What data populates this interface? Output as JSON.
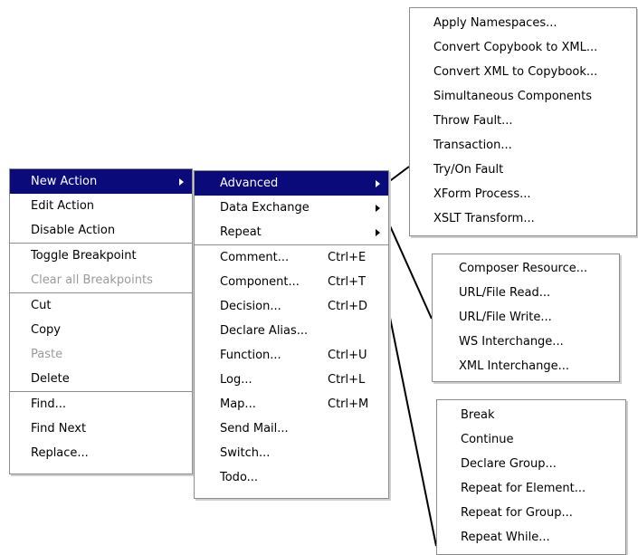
{
  "context_menu": {
    "items": [
      {
        "label": "New Action",
        "has_submenu": true,
        "selected": true
      },
      {
        "label": "Edit Action"
      },
      {
        "label": "Disable Action"
      },
      {
        "label": "Toggle Breakpoint"
      },
      {
        "label": "Clear all Breakpoints",
        "disabled": true
      },
      {
        "label": "Cut"
      },
      {
        "label": "Copy"
      },
      {
        "label": "Paste",
        "disabled": true
      },
      {
        "label": "Delete"
      },
      {
        "label": "Find..."
      },
      {
        "label": "Find Next"
      },
      {
        "label": "Replace..."
      }
    ]
  },
  "new_action_menu": {
    "items": [
      {
        "label": "Advanced",
        "has_submenu": true,
        "selected": true
      },
      {
        "label": "Data Exchange",
        "has_submenu": true
      },
      {
        "label": "Repeat",
        "has_submenu": true
      },
      {
        "label": "Comment...",
        "shortcut": "Ctrl+E"
      },
      {
        "label": "Component...",
        "shortcut": "Ctrl+T"
      },
      {
        "label": "Decision...",
        "shortcut": "Ctrl+D"
      },
      {
        "label": "Declare Alias..."
      },
      {
        "label": "Function...",
        "shortcut": "Ctrl+U"
      },
      {
        "label": "Log...",
        "shortcut": "Ctrl+L"
      },
      {
        "label": "Map...",
        "shortcut": "Ctrl+M"
      },
      {
        "label": "Send Mail..."
      },
      {
        "label": "Switch..."
      },
      {
        "label": "Todo..."
      }
    ]
  },
  "advanced_menu": {
    "items": [
      "Apply Namespaces...",
      "Convert Copybook to XML...",
      "Convert XML to Copybook...",
      "Simultaneous Components",
      "Throw Fault...",
      "Transaction...",
      "Try/On Fault",
      "XForm Process...",
      "XSLT Transform..."
    ]
  },
  "data_exchange_menu": {
    "items": [
      "Composer Resource...",
      "URL/File Read...",
      "URL/File Write...",
      "WS Interchange...",
      "XML Interchange..."
    ]
  },
  "repeat_menu": {
    "items": [
      "Break",
      "Continue",
      "Declare Group...",
      "Repeat for Element...",
      "Repeat for Group...",
      "Repeat While..."
    ]
  },
  "colors": {
    "selection": "#0a0a7a",
    "border": "#8c8c8c",
    "disabled_text": "#9a9a9a"
  }
}
